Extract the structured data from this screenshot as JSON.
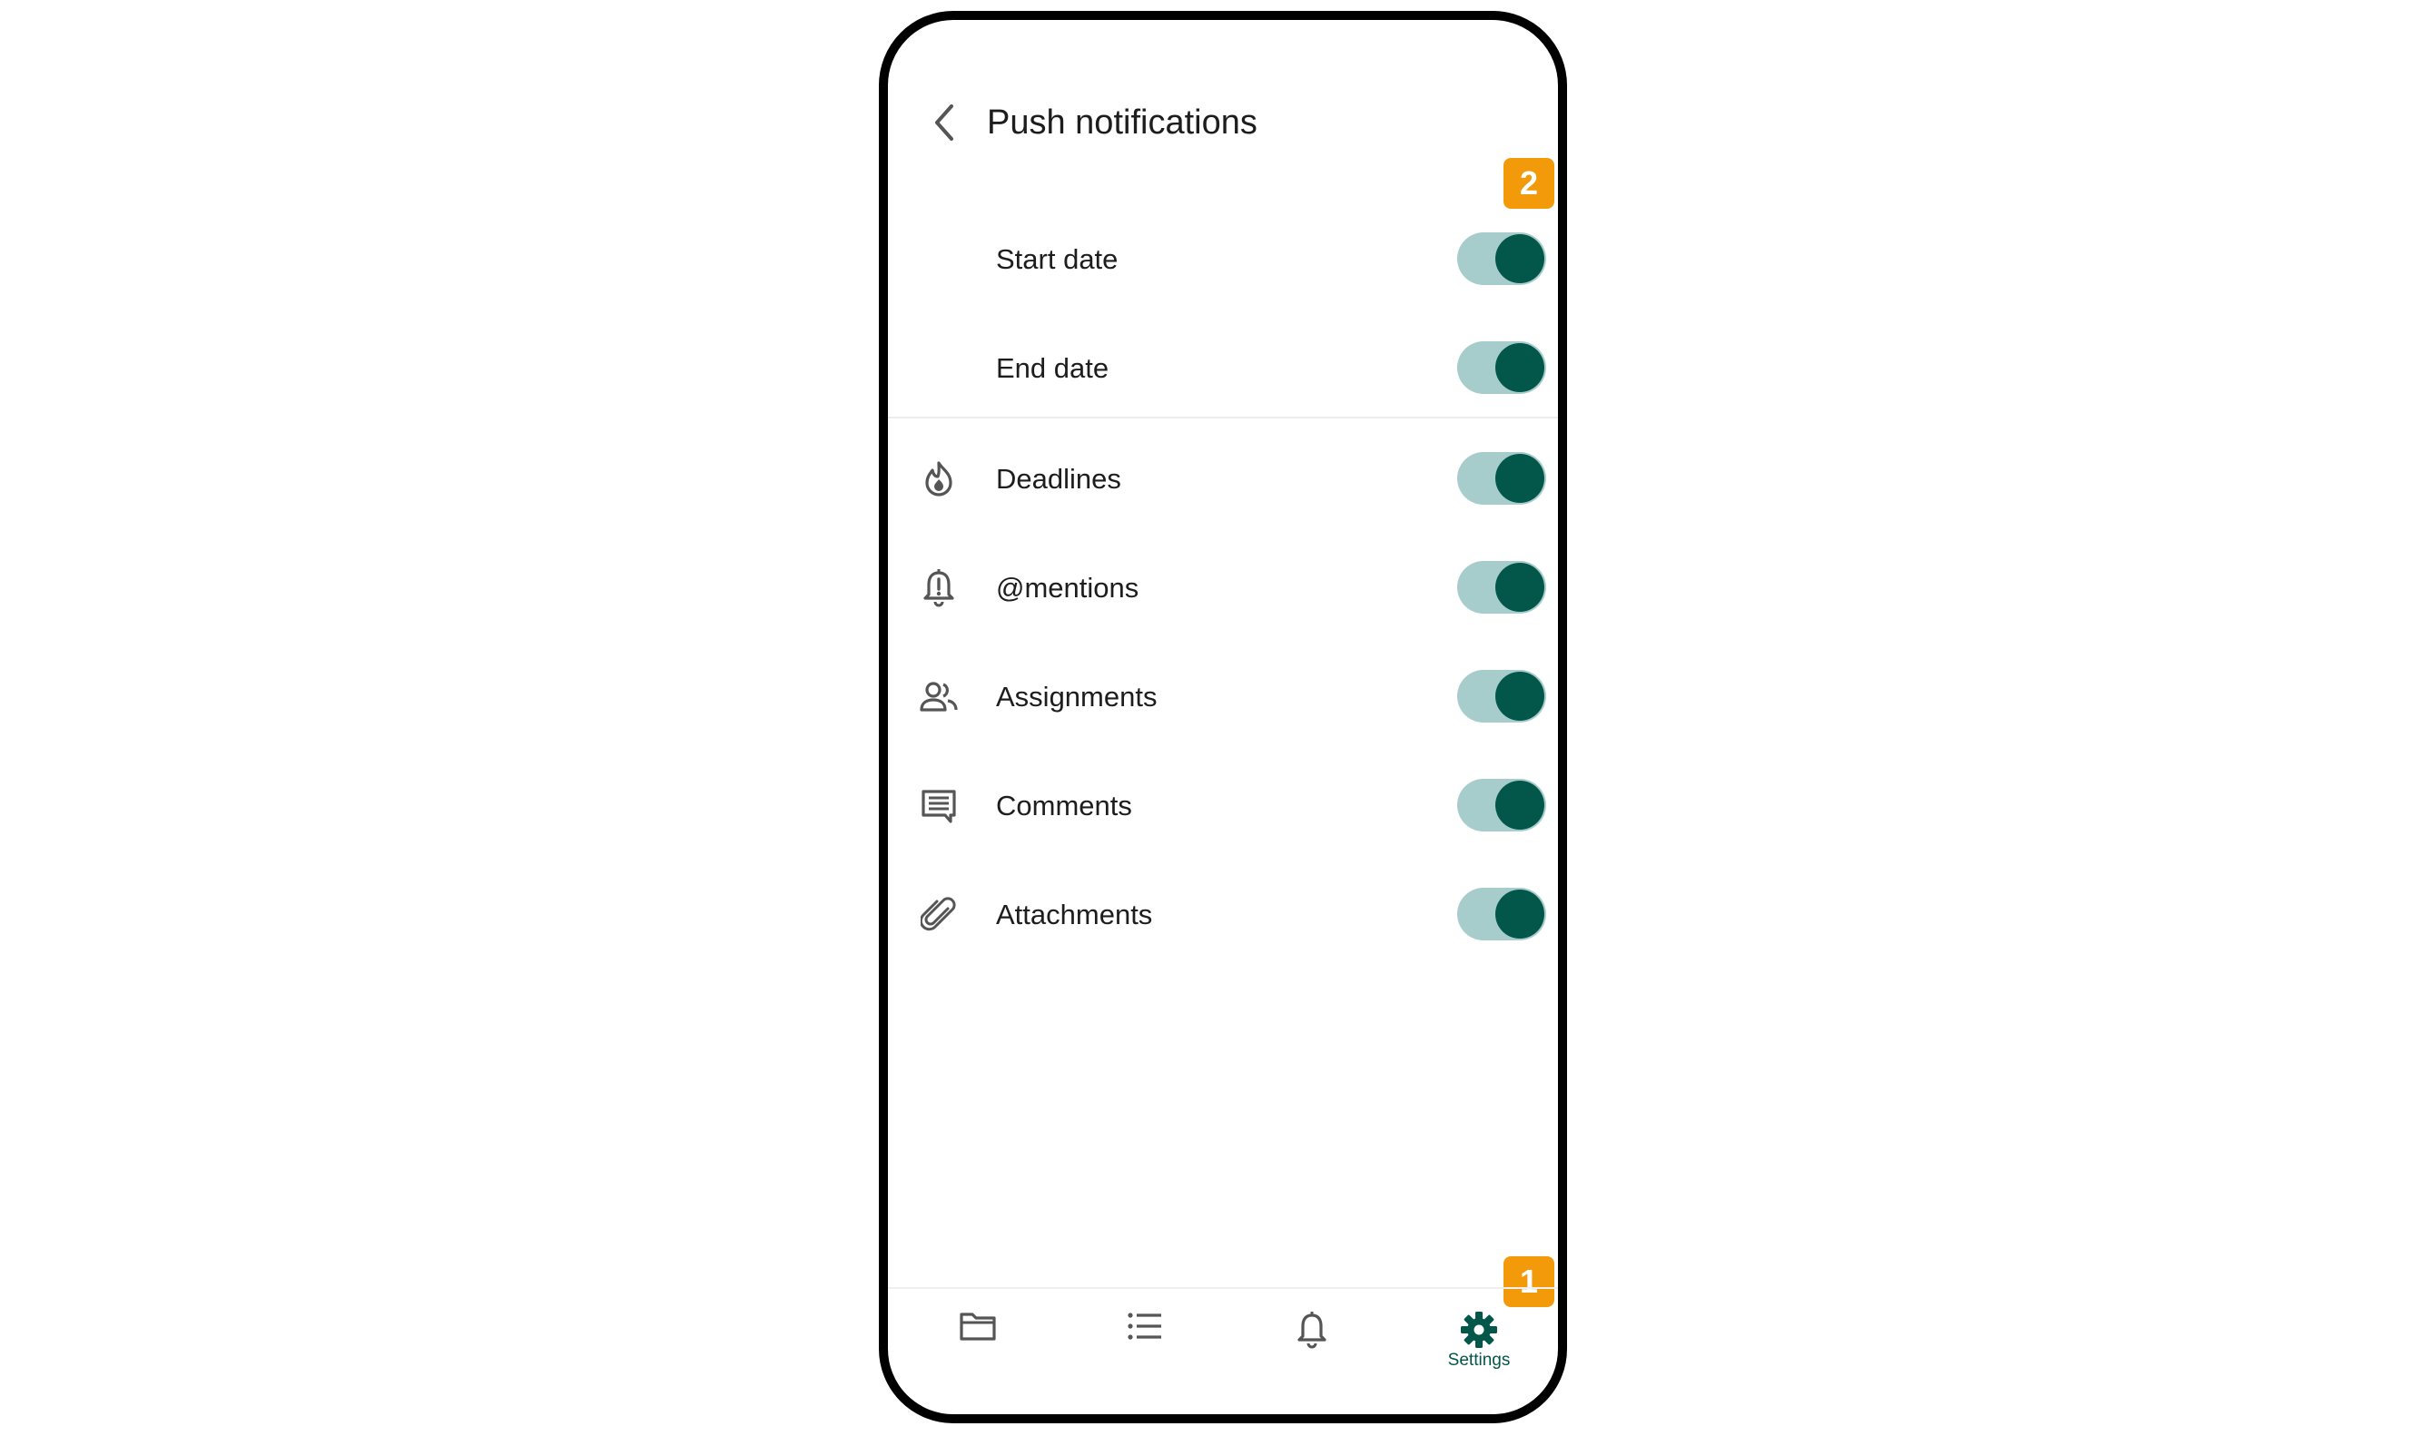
{
  "header": {
    "title": "Push notifications",
    "back_icon": "chevron-left-icon"
  },
  "colors": {
    "accent": "#03574a",
    "toggle_track": "#a6cccb",
    "badge": "#f39a0a"
  },
  "settings": [
    {
      "label": "Start date",
      "icon": "",
      "enabled": true
    },
    {
      "label": "End date",
      "icon": "",
      "enabled": true
    },
    {
      "label": "Deadlines",
      "icon": "deadline-fire-icon",
      "enabled": true
    },
    {
      "label": "@mentions",
      "icon": "bell-alert-icon",
      "enabled": true
    },
    {
      "label": "Assignments",
      "icon": "people-icon",
      "enabled": true
    },
    {
      "label": "Comments",
      "icon": "comment-icon",
      "enabled": true
    },
    {
      "label": "Attachments",
      "icon": "paperclip-icon",
      "enabled": true
    }
  ],
  "nav": {
    "items": [
      {
        "icon": "folder-icon",
        "label": ""
      },
      {
        "icon": "list-icon",
        "label": ""
      },
      {
        "icon": "bell-icon",
        "label": ""
      },
      {
        "icon": "gear-icon",
        "label": "Settings",
        "active": true
      }
    ]
  },
  "badges": {
    "settings_tab": "1",
    "start_date_toggle": "2"
  }
}
